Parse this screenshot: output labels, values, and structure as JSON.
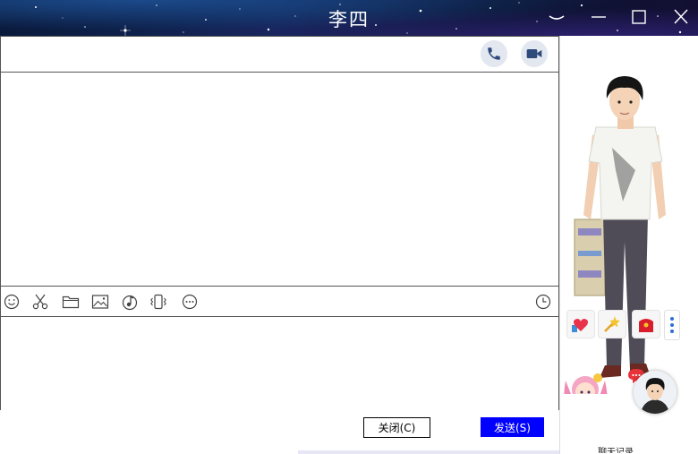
{
  "window": {
    "title": "李四"
  },
  "controls": {
    "dropdown_icon": "chevron-down-icon",
    "minimize_icon": "minimize-icon",
    "maximize_icon": "maximize-icon",
    "close_icon": "close-icon"
  },
  "call_bar": {
    "voice_icon": "phone-icon",
    "video_icon": "video-camera-icon"
  },
  "toolbar": {
    "items": [
      "emoji-icon",
      "scissors-icon",
      "folder-icon",
      "image-icon",
      "music-icon",
      "shake-icon",
      "more-icon"
    ],
    "history_icon": "clock-icon"
  },
  "footer": {
    "close_label": "关闭(C)",
    "send_label": "发送(S)"
  },
  "side_panel": {
    "gifts": [
      "heart-gift-icon",
      "magic-wand-icon",
      "red-envelope-icon"
    ],
    "more_icon": "vertical-dots-icon",
    "cut_text": "聊天记录"
  },
  "colors": {
    "send_button": "#0000ff",
    "more_dots": "#2b6fd6",
    "border": "#555555"
  }
}
